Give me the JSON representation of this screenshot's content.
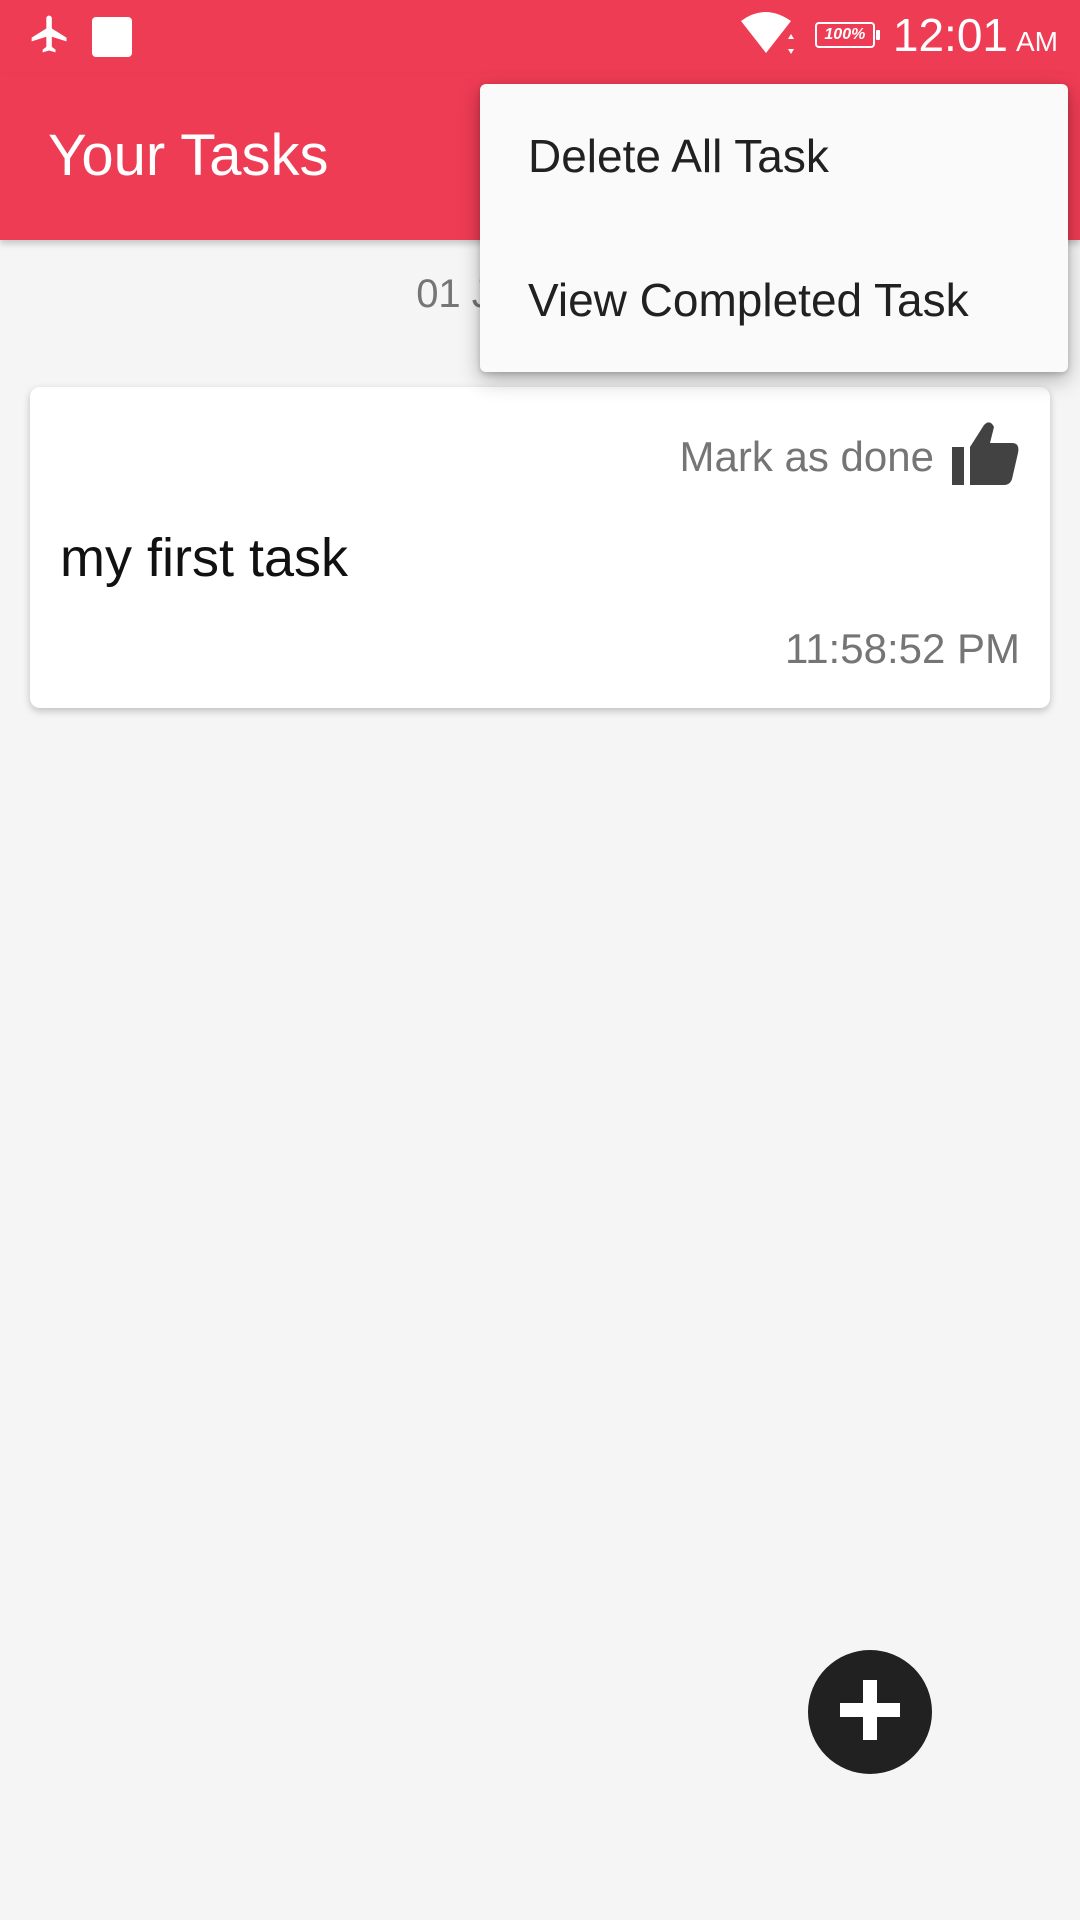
{
  "status_bar": {
    "icons": [
      "airplane-mode-icon",
      "notification-square-icon",
      "wifi-icon",
      "battery-icon"
    ],
    "battery_text": "100%",
    "time": "12:01",
    "ampm": "AM"
  },
  "app_bar": {
    "title": "Your Tasks"
  },
  "date_header": "01 J",
  "tasks": [
    {
      "action_label": "Mark as done",
      "action_icon": "thumbs-up-icon",
      "title": "my first task",
      "time": "11:58:52 PM"
    }
  ],
  "fab": {
    "icon": "plus-icon"
  },
  "overflow_menu": {
    "items": [
      {
        "label": "Delete All Task"
      },
      {
        "label": "View Completed Task"
      }
    ]
  },
  "colors": {
    "primary": "#ee3c54",
    "background": "#f5f5f5",
    "card": "#ffffff",
    "fab": "#212121"
  }
}
